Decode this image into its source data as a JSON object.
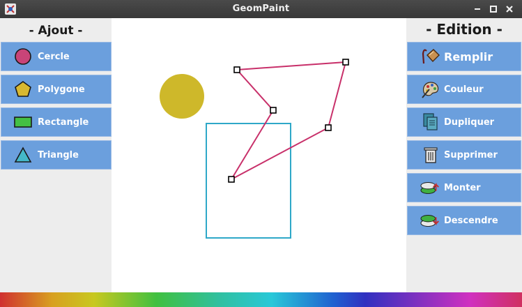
{
  "window": {
    "title": "GeomPaint",
    "icons": [
      "app-icon",
      "minimize-icon",
      "maximize-icon",
      "close-icon"
    ]
  },
  "left_panel": {
    "heading": "- Ajout -",
    "buttons": [
      {
        "label": "Cercle",
        "icon": "circle-icon",
        "color": "#c84478"
      },
      {
        "label": "Polygone",
        "icon": "pentagon-icon",
        "color": "#d8b830"
      },
      {
        "label": "Rectangle",
        "icon": "rectangle-icon",
        "color": "#44c044"
      },
      {
        "label": "Triangle",
        "icon": "triangle-icon",
        "color": "#44b8c8"
      }
    ]
  },
  "right_panel": {
    "heading": "- Edition -",
    "buttons": [
      {
        "label": "Remplir",
        "icon": "paint-bucket-icon"
      },
      {
        "label": "Couleur",
        "icon": "palette-icon"
      },
      {
        "label": "Dupliquer",
        "icon": "duplicate-icon"
      },
      {
        "label": "Supprimer",
        "icon": "trash-icon"
      },
      {
        "label": "Monter",
        "icon": "bring-up-icon"
      },
      {
        "label": "Descendre",
        "icon": "send-down-icon"
      }
    ]
  },
  "canvas": {
    "shapes": [
      {
        "type": "circle",
        "fill": "#ceb82a"
      },
      {
        "type": "rectangle",
        "stroke": "#2ea8c8"
      },
      {
        "type": "polygon",
        "stroke": "#c8306a",
        "selected": true,
        "vertices": 5
      }
    ]
  },
  "colors": {
    "button_bg": "#6b9fdd",
    "panel_bg": "#ededed",
    "titlebar_bg": "#3c3c3c"
  }
}
